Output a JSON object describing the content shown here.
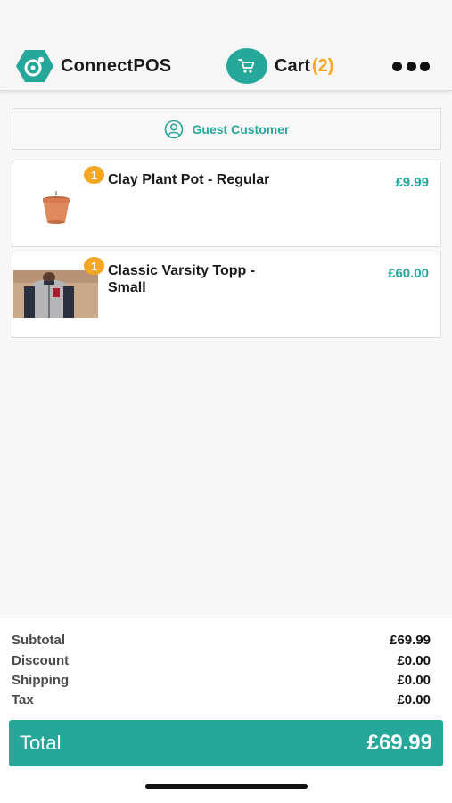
{
  "header": {
    "brand_name": "ConnectPOS",
    "cart_label": "Cart",
    "cart_count": "(2)",
    "icons": {
      "logo": "connectpos-logo-icon",
      "cart": "cart-icon",
      "more": "more-dots-icon"
    }
  },
  "customer": {
    "label": "Guest Customer",
    "icon": "user-circle-icon"
  },
  "items": [
    {
      "name": "Clay Plant Pot - Regular",
      "price": "£9.99",
      "qty": "1"
    },
    {
      "name": "Classic Varsity Topp - Small",
      "price": "£60.00",
      "qty": "1"
    }
  ],
  "totals": {
    "subtotal_label": "Subtotal",
    "subtotal": "£69.99",
    "discount_label": "Discount",
    "discount": "£0.00",
    "shipping_label": "Shipping",
    "shipping": "£0.00",
    "tax_label": "Tax",
    "tax": "£0.00",
    "total_label": "Total",
    "total": "£69.99"
  },
  "colors": {
    "accent": "#25a79a",
    "badge": "#f5a623"
  }
}
